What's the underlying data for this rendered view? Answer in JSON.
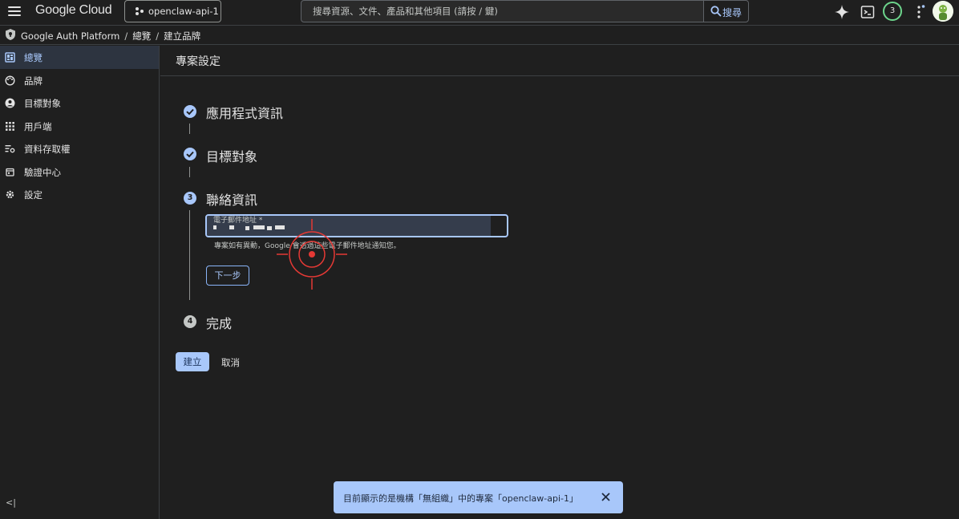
{
  "topbar": {
    "logo": "Google Cloud",
    "project": "openclaw-api-1",
    "search_placeholder": "搜尋資源、文件、產品和其他項目 (請按 / 鍵)",
    "search_label": "搜尋",
    "notification_count": "3"
  },
  "breadcrumb": {
    "product": "Google Auth Platform",
    "items": [
      "總覽",
      "建立品牌"
    ]
  },
  "sidebar": {
    "items": [
      {
        "label": "總覽",
        "icon": "dashboard-icon",
        "active": true
      },
      {
        "label": "品牌",
        "icon": "palette-icon"
      },
      {
        "label": "目標對象",
        "icon": "person-icon"
      },
      {
        "label": "用戶端",
        "icon": "grid-icon"
      },
      {
        "label": "資料存取權",
        "icon": "data-access-icon"
      },
      {
        "label": "驗證中心",
        "icon": "verification-icon"
      },
      {
        "label": "設定",
        "icon": "gear-icon"
      }
    ],
    "collapse": "<|"
  },
  "main": {
    "title": "專案設定",
    "steps": [
      {
        "number": "1",
        "title": "應用程式資訊",
        "status": "done"
      },
      {
        "number": "2",
        "title": "目標對象",
        "status": "done"
      },
      {
        "number": "3",
        "title": "聯絡資訊",
        "status": "active"
      },
      {
        "number": "4",
        "title": "完成",
        "status": "pending"
      }
    ],
    "email_label": "電子郵件地址 *",
    "email_hint": "專案如有異動，Google 會透過這些電子郵件地址通知您。",
    "next_label": "下一步",
    "create_label": "建立",
    "cancel_label": "取消"
  },
  "snackbar": {
    "message": "目前顯示的是機構「無組織」中的專案「openclaw-api-1」"
  },
  "colors": {
    "accent": "#a8c7fa",
    "background": "#1f1f1f",
    "target": "#e53935"
  }
}
